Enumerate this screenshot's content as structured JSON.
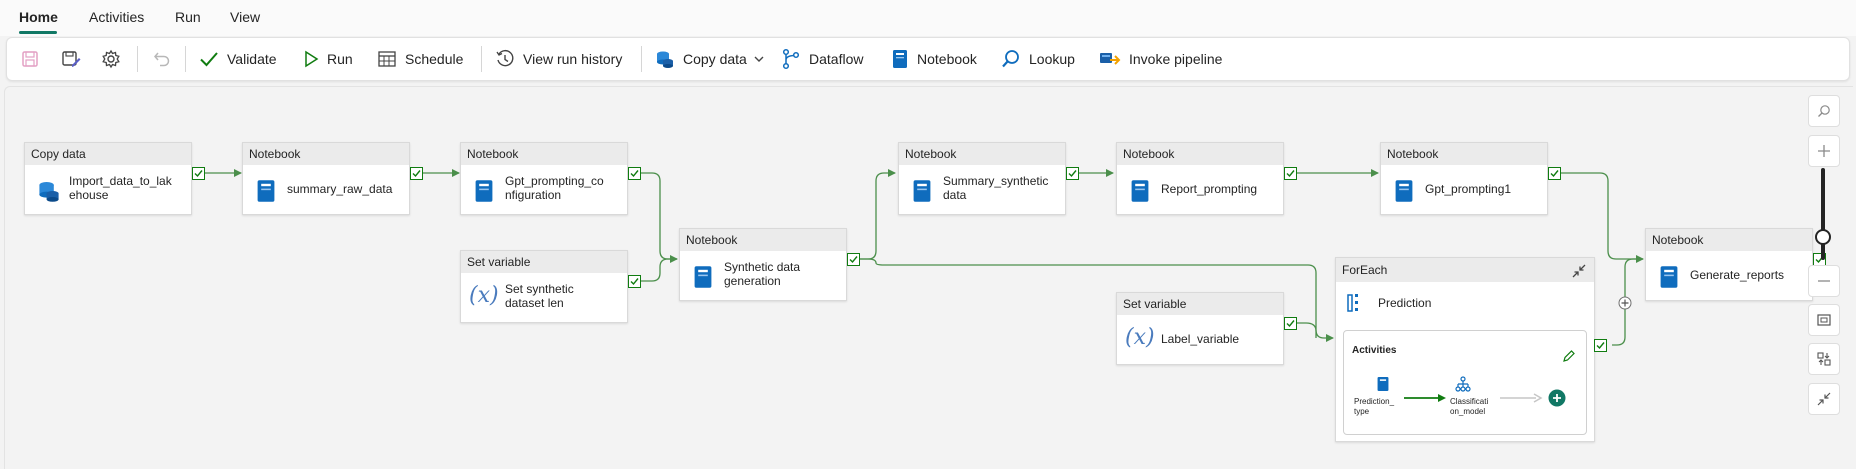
{
  "tabs": [
    {
      "label": "Home",
      "active": true
    },
    {
      "label": "Activities",
      "active": false
    },
    {
      "label": "Run",
      "active": false
    },
    {
      "label": "View",
      "active": false
    }
  ],
  "toolbar": {
    "validate": "Validate",
    "run": "Run",
    "schedule": "Schedule",
    "view_run_history": "View run history",
    "copy_data": "Copy data",
    "dataflow": "Dataflow",
    "notebook": "Notebook",
    "lookup": "Lookup",
    "invoke_pipeline": "Invoke pipeline"
  },
  "nodes": {
    "copy_data": {
      "type": "Copy data",
      "name": "Import_data_to_lakehouse",
      "name_line1": "Import_data_to_lak",
      "name_line2": "ehouse"
    },
    "summary_raw": {
      "type": "Notebook",
      "name": "summary_raw_data"
    },
    "gpt_config": {
      "type": "Notebook",
      "name_line1": "Gpt_prompting_co",
      "name_line2": "nfiguration"
    },
    "set_synthetic": {
      "type": "Set variable",
      "name_line1": "Set synthetic",
      "name_line2": "dataset len"
    },
    "synthetic_gen": {
      "type": "Notebook",
      "name_line1": "Synthetic data",
      "name_line2": "generation"
    },
    "summary_synth": {
      "type": "Notebook",
      "name_line1": "Summary_synthetic",
      "name_line2": "data"
    },
    "report_prompting": {
      "type": "Notebook",
      "name": "Report_prompting"
    },
    "gpt_prompting1": {
      "type": "Notebook",
      "name": "Gpt_prompting1"
    },
    "label_variable": {
      "type": "Set variable",
      "name": "Label_variable"
    },
    "generate_reports": {
      "type": "Notebook",
      "name": "Generate_reports"
    }
  },
  "foreach": {
    "type": "ForEach",
    "name": "Prediction",
    "activities_title": "Activities",
    "act1_line1": "Prediction_",
    "act1_line2": "type",
    "act2_line1": "Classificati",
    "act2_line2": "on_model"
  },
  "colors": {
    "accent": "#117865",
    "success": "#107c10",
    "notebook": "#0f6cbd",
    "edge": "#4b8f4b"
  }
}
